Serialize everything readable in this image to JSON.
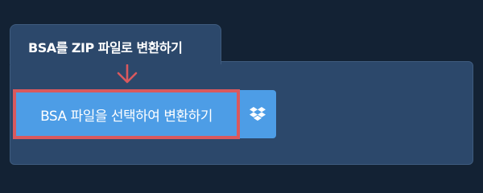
{
  "tab": {
    "title": "BSA를 ZIP 파일로 변환하기"
  },
  "converter": {
    "select_button_label": "BSA 파일을 선택하여 변환하기",
    "dropbox_icon": "dropbox-icon"
  },
  "colors": {
    "background": "#132234",
    "panel": "#2c486b",
    "button": "#4d9de6",
    "highlight": "#d9595e"
  }
}
